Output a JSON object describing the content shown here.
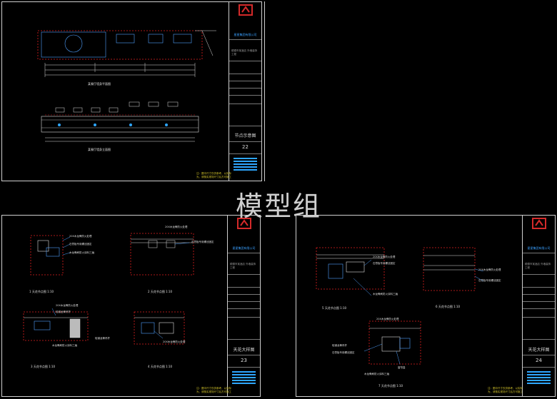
{
  "watermark": "模型组",
  "company": "星星集团有限公司",
  "sheets": [
    {
      "title": "节点示意图",
      "number": "22",
      "drawing_labels": [
        "某餐厅墙身平面图",
        "某餐厅墙身立面图"
      ]
    },
    {
      "title": "天花大样图",
      "number": "23",
      "drawing_labels": [
        "1 天花节点图 1:10",
        "2 天花节点图 1:10",
        "3 天花节点图 1:10",
        "4 天花节点图 1:10"
      ],
      "callouts": [
        "20X木龙骨防火处理",
        "石膏板专用螺丝固定",
        "木龙骨刷防火涂料三遍",
        "轻钢龙骨吊杆"
      ]
    },
    {
      "title": "天花大样图",
      "number": "24",
      "drawing_labels": [
        "5 天花节点图 1:10",
        "6 天花节点图 1:10",
        "7 天花节点图 1:10"
      ],
      "callouts": [
        "20X木龙骨防火处理",
        "石膏板专用螺丝固定",
        "木龙骨刷防火涂料三遍",
        "轻钢龙骨吊杆",
        "窗帘盒"
      ]
    }
  ],
  "titleblock": {
    "project": "顺德市某酒店 外墙装饰工程",
    "notes": [
      "注：图中尺寸仅供参考，以实际",
      "为，请核实现场尺寸后方可施工"
    ]
  },
  "colors": {
    "sheet_border": "#cfcfcf",
    "accent_blue": "#2ea6ff",
    "logo_red": "#d42a2a",
    "drawing_red": "#e02020",
    "note_yellow": "#d9c92b"
  }
}
